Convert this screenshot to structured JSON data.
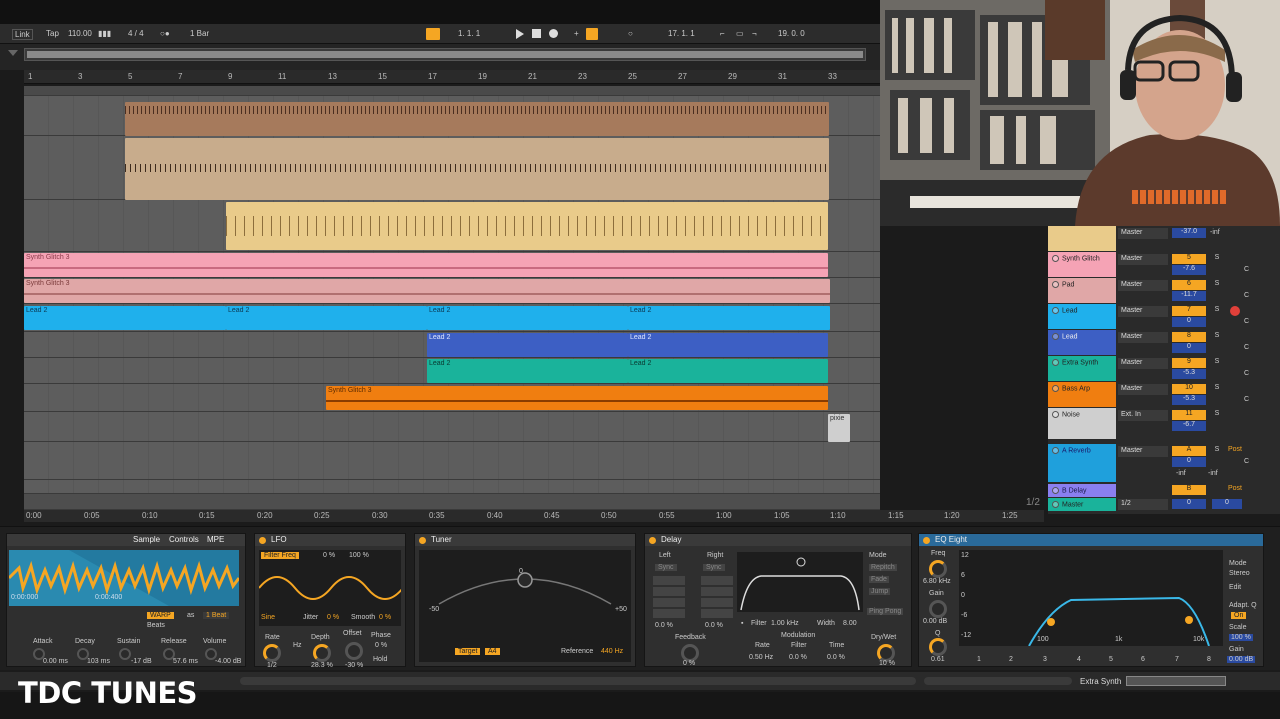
{
  "transport": {
    "link": "Link",
    "tap": "Tap",
    "tempo": "110.00",
    "signature": "4 / 4",
    "quantize": "1 Bar",
    "position": "1.   1.   1",
    "loop_start": "17.   1.   1",
    "loop_length": "19.   0.   0"
  },
  "ruler": {
    "bars": [
      "1",
      "3",
      "5",
      "7",
      "9",
      "11",
      "13",
      "15",
      "17",
      "19",
      "21",
      "23",
      "25",
      "27",
      "29",
      "31",
      "33"
    ]
  },
  "timeline": {
    "times": [
      "0:00",
      "0:05",
      "0:10",
      "0:15",
      "0:20",
      "0:25",
      "0:30",
      "0:35",
      "0:40",
      "0:45",
      "0:50",
      "0:55",
      "1:00",
      "1:05",
      "1:10",
      "1:15",
      "1:20",
      "1:25"
    ],
    "page": "1/2"
  },
  "clips": {
    "synth_glitch_a": "Synth Glitch 3",
    "synth_glitch_b": "Synth Glitch 3",
    "lead_1": "Lead 2",
    "lead_2": "Lead 2",
    "lead_3": "Lead 2",
    "lead_4": "Lead 2",
    "lead_5": "Lead 2",
    "lead_6": "Lead 2",
    "lead_7": "Lead 2",
    "lead_8": "Lead 2",
    "synth_glitch_c": "Synth Glitch 3",
    "noise": "pixie"
  },
  "mixer": {
    "master_label": "Master",
    "vol_top": "-37.0",
    "inf": "-inf",
    "tracks": [
      {
        "name": "Synth Glitch",
        "route": "Master",
        "num": "5",
        "vol": "-7.6"
      },
      {
        "name": "Pad",
        "route": "Master",
        "num": "6",
        "vol": "-11.7"
      },
      {
        "name": "Lead",
        "route": "Master",
        "num": "7",
        "vol": "0"
      },
      {
        "name": "Lead",
        "route": "Master",
        "num": "8",
        "vol": "0"
      },
      {
        "name": "Extra Synth",
        "route": "Master",
        "num": "9",
        "vol": "-5.3"
      },
      {
        "name": "Bass Arp",
        "route": "Master",
        "num": "10",
        "vol": "-5.3"
      },
      {
        "name": "Noise",
        "route": "Ext. In",
        "num": "11",
        "vol": "-6.7"
      },
      {
        "name": "A Reverb",
        "route": "Master",
        "num": "A",
        "vol": "0"
      }
    ],
    "b_delay": "B Delay",
    "b_letter": "B",
    "master": "Master",
    "master_page": "1/2",
    "master_vol": "0",
    "master_vol2": "0",
    "post": "Post",
    "c": "C",
    "s": "S"
  },
  "devices": {
    "sampler": {
      "tab_sample": "Sample",
      "tab_controls": "Controls",
      "tab_mpe": "MPE",
      "warp": "WARP",
      "as": "as",
      "beat": "1 Beat",
      "beats": "Beats",
      "t1": "0:00:000",
      "t2": "0:00:400",
      "attack": "Attack",
      "decay": "Decay",
      "sustain": "Sustain",
      "release": "Release",
      "volume": "Volume",
      "attack_v": "0.00 ms",
      "decay_v": "103 ms",
      "sustain_v": "-17 dB",
      "release_v": "57.6 ms",
      "volume_v": "-4.00 dB"
    },
    "lfo": {
      "title": "LFO",
      "target": "Filter Freq",
      "pct": "0 %",
      "pct2": "100 %",
      "shape": "Sine",
      "jitter": "Jitter",
      "jitter_v": "0 %",
      "smooth": "Smooth",
      "smooth_v": "0 %",
      "rate": "Rate",
      "depth": "Depth",
      "offset": "Offset",
      "phase": "Phase",
      "hz": "Hz",
      "hold": "Hold",
      "rate_v": "1/2",
      "depth_v": "28.3 %",
      "offset_v": "-30 %",
      "phase_v": "0 %",
      "phase_v2": "0 %"
    },
    "tuner": {
      "title": "Tuner",
      "left": "-50",
      "right": "+50",
      "center": "0",
      "target": "Target",
      "target_v": "A4",
      "reference": "Reference",
      "reference_v": "440 Hz"
    },
    "delay": {
      "title": "Delay",
      "left": "Left",
      "right": "Right",
      "sync": "Sync",
      "left_pct": "0.0 %",
      "right_pct": "0.0 %",
      "mode": "Mode",
      "repitch": "Repitch",
      "fade": "Fade",
      "jump": "Jump",
      "ping_pong": "Ping Pong",
      "feedback": "Feedback",
      "feedback_v": "0 %",
      "filter": "Filter",
      "filter_v": "1.00 kHz",
      "width": "Width",
      "width_v": "8.00",
      "modulation": "Modulation",
      "rate": "Rate",
      "filter2": "Filter",
      "time": "Time",
      "rate_v": "0.50 Hz",
      "filter2_v": "0.0 %",
      "time_v": "0.0 %",
      "drywet": "Dry/Wet",
      "drywet_v": "10 %"
    },
    "eq": {
      "title": "EQ Eight",
      "freq": "Freq",
      "freq_v": "6.80 kHz",
      "gain": "Gain",
      "gain_v": "0.00 dB",
      "q": "Q",
      "q_v": "0.61",
      "mode": "Mode",
      "mode_v": "Stereo",
      "edit": "Edit",
      "adapt": "Adapt. Q",
      "adapt_v": "On",
      "scale": "Scale",
      "scale_v": "100 %",
      "gain2": "Gain",
      "gain2_v": "0.00 dB",
      "db": [
        "12",
        "6",
        "0",
        "-6",
        "-12"
      ],
      "hz": [
        "100",
        "1k",
        "10k"
      ],
      "bands": [
        "1",
        "2",
        "3",
        "4",
        "5",
        "6",
        "7",
        "8"
      ]
    }
  },
  "status": {
    "track_name": "Extra Synth"
  },
  "watermark": "TDC TUNES",
  "colors": {
    "accent": "#f5a623",
    "pink": "#f19ab0",
    "blue": "#1fb0ec",
    "darkblue": "#3d5fc4",
    "teal": "#1ab39b",
    "orange": "#f07e10"
  }
}
